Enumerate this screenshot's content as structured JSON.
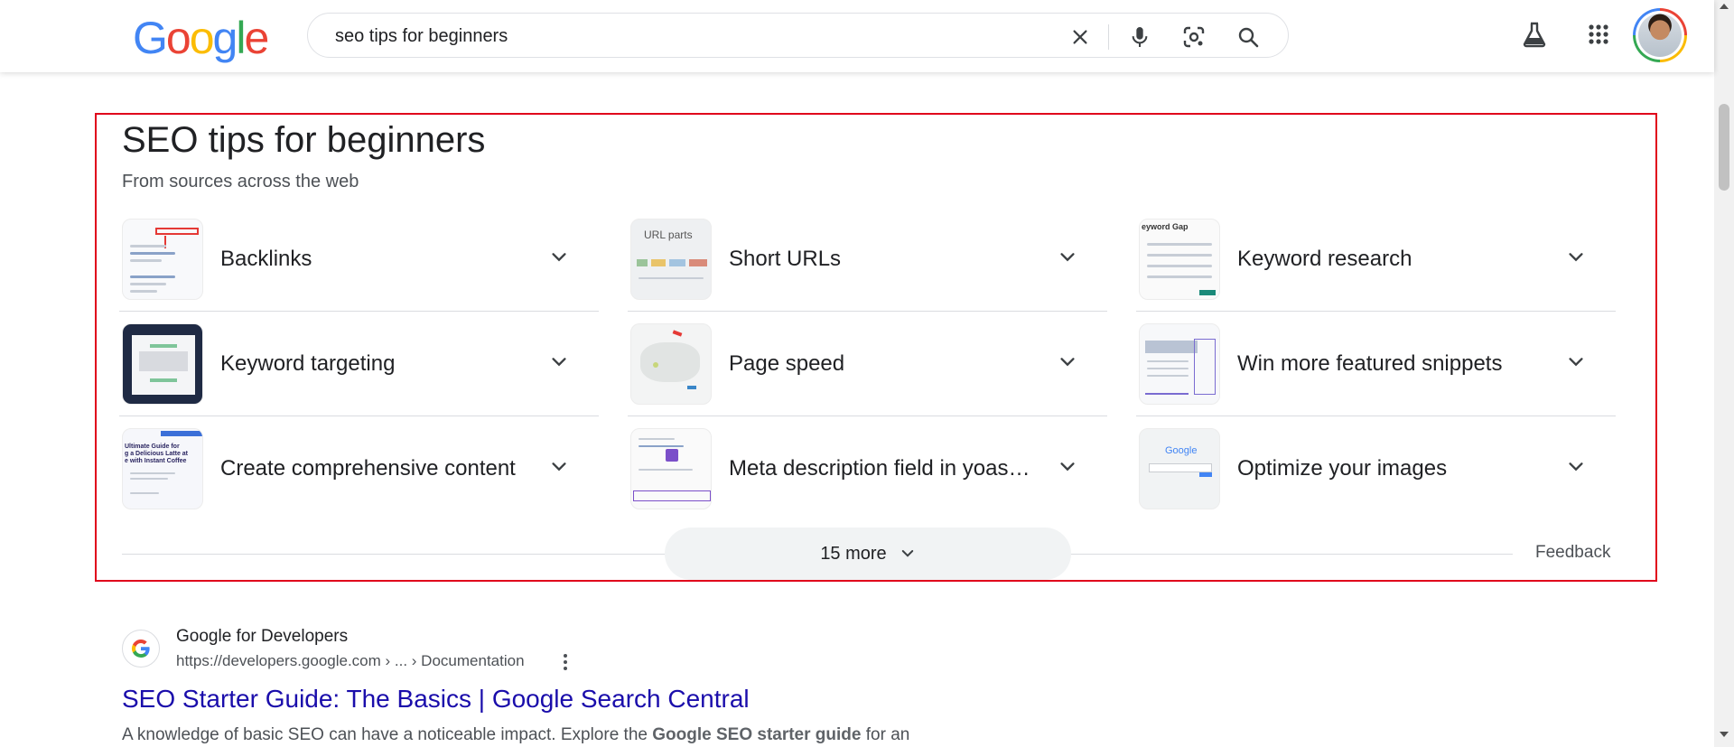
{
  "header": {
    "logo_letters": [
      {
        "ch": "G",
        "color": "#4285f4"
      },
      {
        "ch": "o",
        "color": "#ea4335"
      },
      {
        "ch": "o",
        "color": "#fbbc05"
      },
      {
        "ch": "g",
        "color": "#4285f4"
      },
      {
        "ch": "l",
        "color": "#34a853"
      },
      {
        "ch": "e",
        "color": "#ea4335"
      }
    ],
    "search_value": "seo tips for beginners",
    "icons": [
      "clear-icon",
      "microphone-icon",
      "lens-icon",
      "search-icon",
      "labs-flask-icon",
      "apps-grid-icon",
      "avatar"
    ]
  },
  "panel": {
    "title": "SEO tips for beginners",
    "subtitle": "From sources across the web",
    "items": [
      {
        "label": "Backlinks"
      },
      {
        "label": "Short URLs"
      },
      {
        "label": "Keyword research"
      },
      {
        "label": "Keyword targeting"
      },
      {
        "label": "Page speed"
      },
      {
        "label": "Win more featured snippets"
      },
      {
        "label": "Create comprehensive content"
      },
      {
        "label": "Meta description field in yoast…"
      },
      {
        "label": "Optimize your images"
      }
    ],
    "thumb_texts": {
      "short_urls": "URL parts",
      "keyword_research": "eyword Gap",
      "comprehensive": "Ultimate Guide for\ng a Delicious Latte at\ne with Instant Coffee",
      "optimize_images": "Google"
    },
    "more_label": "15 more",
    "feedback_label": "Feedback"
  },
  "result": {
    "site_name": "Google for Developers",
    "url": "https://developers.google.com › ... › Documentation",
    "title": "SEO Starter Guide: The Basics | Google Search Central",
    "snippet_start": "A knowledge of basic SEO can have a noticeable impact. Explore the ",
    "snippet_bold": "Google SEO starter guide",
    "snippet_end": " for an"
  },
  "colors": {
    "highlight_border": "#e0001b",
    "link": "#1a0dab",
    "google_blue": "#4285f4",
    "google_red": "#ea4335",
    "google_yellow": "#fbbc05",
    "google_green": "#34a853"
  }
}
